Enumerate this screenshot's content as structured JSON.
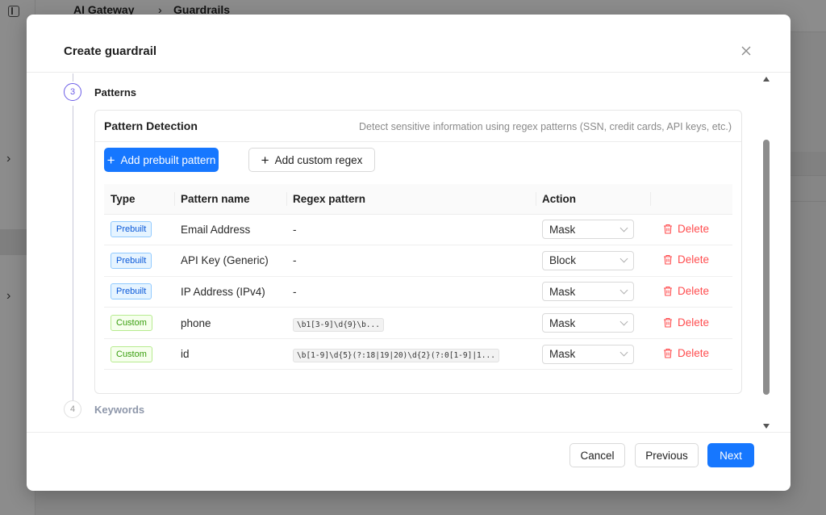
{
  "background": {
    "breadcrumb_app": "AI Gateway",
    "breadcrumb_page": "Guardrails"
  },
  "modal": {
    "title": "Create guardrail",
    "steps": {
      "active": {
        "number": "3",
        "label": "Patterns"
      },
      "next": {
        "number": "4",
        "label": "Keywords"
      }
    },
    "section": {
      "title": "Pattern Detection",
      "description": "Detect sensitive information using regex patterns (SSN, credit cards, API keys, etc.)",
      "add_prebuilt_label": "Add prebuilt pattern",
      "add_custom_label": "Add custom regex"
    },
    "table": {
      "headers": {
        "type": "Type",
        "name": "Pattern name",
        "regex": "Regex pattern",
        "action": "Action"
      },
      "rows": [
        {
          "type": "Prebuilt",
          "name": "Email Address",
          "regex": "-",
          "action": "Mask",
          "delete": "Delete"
        },
        {
          "type": "Prebuilt",
          "name": "API Key (Generic)",
          "regex": "-",
          "action": "Block",
          "delete": "Delete"
        },
        {
          "type": "Prebuilt",
          "name": "IP Address (IPv4)",
          "regex": "-",
          "action": "Mask",
          "delete": "Delete"
        },
        {
          "type": "Custom",
          "name": "phone",
          "regex": "\\b1[3-9]\\d{9}\\b...",
          "action": "Mask",
          "delete": "Delete"
        },
        {
          "type": "Custom",
          "name": "id",
          "regex": "\\b[1-9]\\d{5}(?:18|19|20)\\d{2}(?:0[1-9]|1...",
          "action": "Mask",
          "delete": "Delete"
        }
      ]
    },
    "footer": {
      "cancel_label": "Cancel",
      "previous_label": "Previous",
      "next_label": "Next"
    }
  },
  "colors": {
    "primary": "#1677ff",
    "step_active": "#6b5ce7",
    "danger": "#ff4d4f",
    "tag_prebuilt": "#0958d9",
    "tag_custom": "#389e0d"
  }
}
